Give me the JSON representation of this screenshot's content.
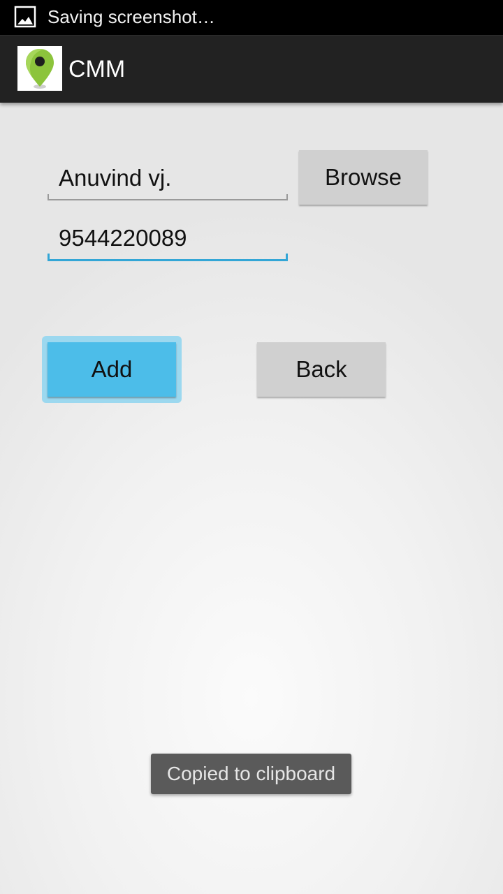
{
  "status_bar": {
    "notification_text": "Saving screenshot…",
    "icon": "image-icon"
  },
  "action_bar": {
    "app_icon": "map-pin-icon",
    "title": "CMM"
  },
  "form": {
    "name_value": "Anuvind vj.",
    "phone_value": "9544220089",
    "browse_label": "Browse",
    "add_label": "Add",
    "back_label": "Back"
  },
  "toast": {
    "text": "Copied to clipboard"
  },
  "colors": {
    "accent": "#33a6d6",
    "add_button": "#4cbde9",
    "action_bar": "#222222",
    "pin_green": "#8cc43c"
  }
}
